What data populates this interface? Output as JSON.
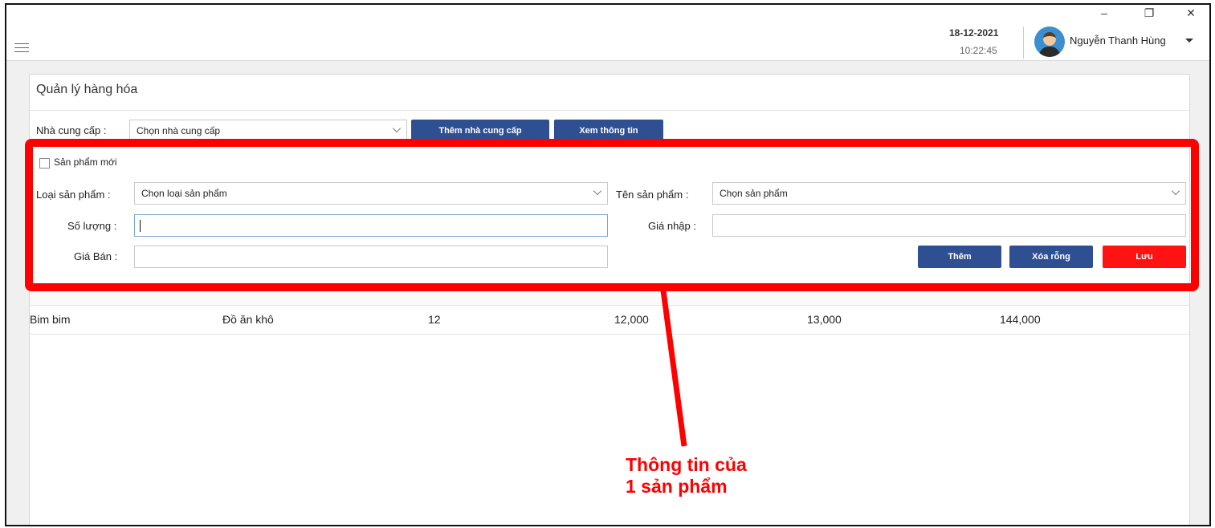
{
  "window": {
    "minimize_glyph": "–",
    "restore_glyph": "❐",
    "close_glyph": "✕"
  },
  "header": {
    "date": "18-12-2021",
    "time": "10:22:45",
    "user_name": "Nguyễn Thanh Hùng"
  },
  "page": {
    "title": "Quản lý hàng hóa"
  },
  "supplier": {
    "label": "Nhà cung cấp :",
    "select_value": "Chọn nhà cung cấp",
    "add_button": "Thêm nhà cung cấp",
    "view_button": "Xem thông tin"
  },
  "product_form": {
    "new_product_checkbox": "Sản phẩm mới",
    "category_label": "Loại sản phẩm :",
    "category_value": "Chọn loại sản phẩm",
    "name_label": "Tên sản phẩm :",
    "name_value": "Chọn sản phẩm",
    "quantity_label": "Số lượng :",
    "quantity_value": "",
    "import_price_label": "Giá nhập :",
    "import_price_value": "",
    "sale_price_label": "Giá Bán :",
    "sale_price_value": "",
    "add_button": "Thêm",
    "clear_button": "Xóa rỗng",
    "save_button": "Lưu"
  },
  "table": {
    "rows": [
      {
        "name": "Bim bim",
        "category": "Đồ ăn khô",
        "quantity": "12",
        "import_price": "12,000",
        "sale_price": "13,000",
        "total": "144,000"
      }
    ]
  },
  "annotation": {
    "line1": "Thông tin của",
    "line2": "1 sản phẩm"
  },
  "colors": {
    "primary_button": "#2f4f93",
    "danger_button": "#ff1212",
    "annotation": "#ff0000"
  }
}
